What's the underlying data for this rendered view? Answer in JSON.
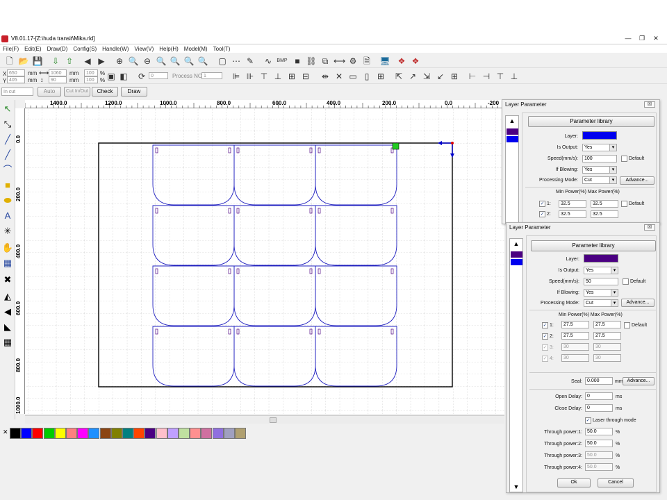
{
  "window": {
    "title": "V8.01.17-[Z:\\huda transit\\Mika.rld]",
    "controls": [
      "—",
      "❐",
      "✕"
    ]
  },
  "menu": [
    "File(F)",
    "Edit(E)",
    "Draw(D)",
    "Config(S)",
    "Handle(W)",
    "View(V)",
    "Help(H)",
    "Model(M)",
    "Tool(T)"
  ],
  "toolbar2": {
    "x_label": "X",
    "y_label": "Y",
    "x_value": "650",
    "y_value": "405",
    "unit_mm": "mm",
    "w_value": "1060",
    "h_value": "90",
    "pct_w": "100",
    "pct_h": "100",
    "pct": "%",
    "rotate_value": "0",
    "process_no_label": "Process NO:",
    "process_no_value": "1"
  },
  "toolbar3": {
    "mode_select": "In cut",
    "auto_label": "Auto",
    "cut_inout_label": "Cut In/Out",
    "check_button": "Check",
    "draw_button": "Draw"
  },
  "rulers": {
    "top_ticks": [
      "1400.0",
      "1200.0",
      "1000.0",
      "800.0",
      "600.0",
      "400.0",
      "200.0",
      "0.0",
      "-200"
    ],
    "left_ticks": [
      "0.0",
      "200.0",
      "400.0",
      "600.0",
      "800.0",
      "1000.0"
    ]
  },
  "palette": {
    "close_glyph": "✕",
    "colors": [
      "#000000",
      "#0000ff",
      "#ff0000",
      "#00cc00",
      "#ffff00",
      "#ff8080",
      "#ff00ff",
      "#1e90ff",
      "#8b4513",
      "#808000",
      "#008080",
      "#ff4500",
      "#4b0082",
      "#ffc0cb",
      "#c0a0ff",
      "#c0e0a0",
      "#ff9090",
      "#d070a0",
      "#9070e0",
      "#a0a0c0",
      "#b0a070"
    ]
  },
  "layer_panel_1": {
    "title": "Layer Parameter",
    "close": "☒",
    "library_button": "Parameter library",
    "layer_label": "Layer:",
    "layer_color": "#0000ee",
    "strip_colors": [
      "#4b0082",
      "#0000ee"
    ],
    "is_output_label": "Is Output:",
    "is_output_value": "Yes",
    "speed_label": "Speed(mm/s):",
    "speed_value": "100",
    "default_label": "Default",
    "blowing_label": "If Blowing:",
    "blowing_value": "Yes",
    "mode_label": "Processing Mode:",
    "mode_value": "Cut",
    "advance_button": "Advance...",
    "power_header": "Min Power(%) Max Power(%)",
    "powers": [
      {
        "n": "1:",
        "min": "32.5",
        "max": "32.5"
      },
      {
        "n": "2:",
        "min": "32.5",
        "max": "32.5"
      }
    ]
  },
  "layer_panel_2": {
    "title": "Layer Parameter",
    "close": "☒",
    "library_button": "Parameter library",
    "layer_label": "Layer:",
    "layer_color": "#4b0082",
    "strip_colors": [
      "#4b0082",
      "#0000ee"
    ],
    "is_output_label": "Is Output:",
    "is_output_value": "Yes",
    "speed_label": "Speed(mm/s):",
    "speed_value": "50",
    "default_label": "Default",
    "blowing_label": "If Blowing:",
    "blowing_value": "Yes",
    "mode_label": "Processing Mode:",
    "mode_value": "Cut",
    "advance_button": "Advance...",
    "power_header": "Min Power(%) Max Power(%)",
    "powers": [
      {
        "n": "1:",
        "min": "27.5",
        "max": "27.5",
        "enabled": true
      },
      {
        "n": "2:",
        "min": "27.5",
        "max": "27.5",
        "enabled": true
      },
      {
        "n": "3:",
        "min": "30",
        "max": "30",
        "enabled": false
      },
      {
        "n": "4:",
        "min": "30",
        "max": "30",
        "enabled": false
      }
    ],
    "seal_label": "Seal:",
    "seal_value": "0.000",
    "seal_unit": "mm",
    "advance2_button": "Advance...",
    "open_delay_label": "Open Delay:",
    "open_delay_value": "0",
    "close_delay_label": "Close Delay:",
    "close_delay_value": "0",
    "ms": "ms",
    "through_mode_label": "Laser through mode",
    "through": [
      {
        "label": "Through power:1:",
        "value": "50.0",
        "enabled": true
      },
      {
        "label": "Through power:2:",
        "value": "50.0",
        "enabled": true
      },
      {
        "label": "Through power:3:",
        "value": "50.0",
        "enabled": false
      },
      {
        "label": "Through power:4:",
        "value": "50.0",
        "enabled": false
      }
    ],
    "pct": "%",
    "ok_button": "Ok",
    "cancel_button": "Cancel"
  }
}
